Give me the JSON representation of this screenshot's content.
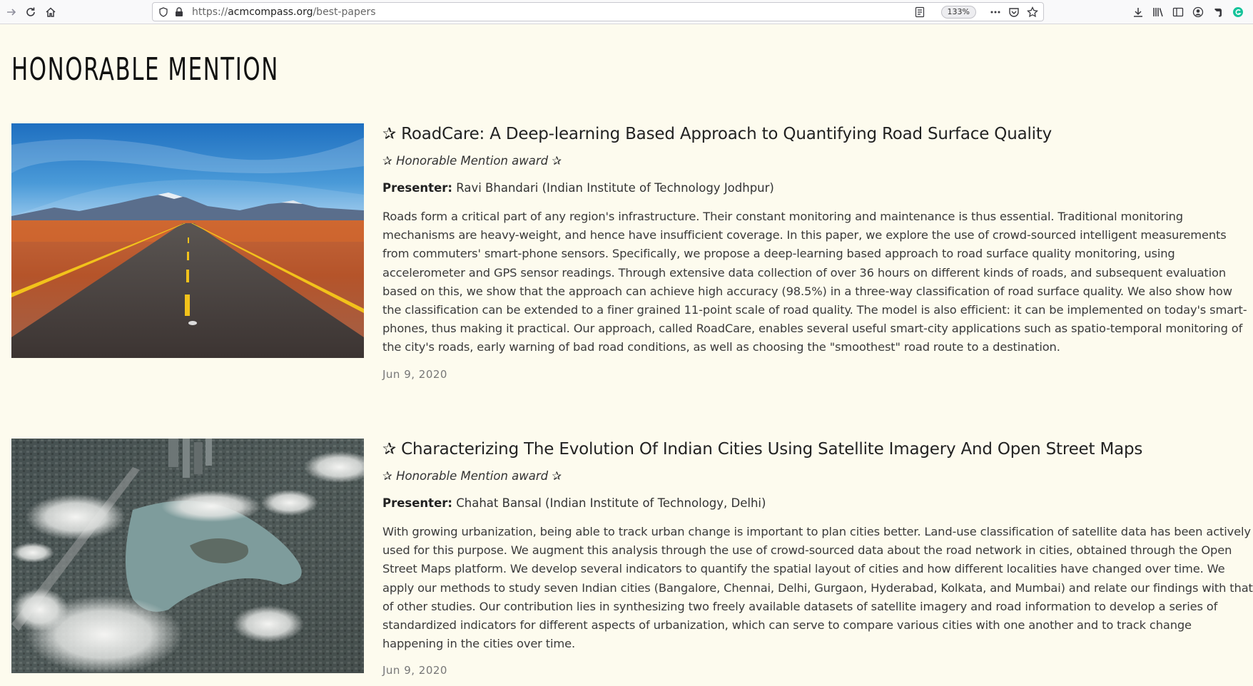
{
  "browser": {
    "url_prefix": "https://",
    "url_host": "acmcompass.org",
    "url_path": "/best-papers",
    "zoom": "133%"
  },
  "page": {
    "title": "HONORABLE MENTION"
  },
  "entries": [
    {
      "title": "✰ RoadCare: A Deep-learning Based Approach to Quantifying Road Surface Quality",
      "award": "✰ Honorable Mention award ✰",
      "presenter_label": "Presenter:",
      "presenter": "Ravi Bhandari (Indian Institute of Technology Jodhpur)",
      "abstract": "Roads form a critical part of any region's infrastructure. Their constant monitoring and maintenance is thus essential. Traditional monitoring mechanisms are heavy-weight, and hence have insufficient coverage. In this paper, we explore the use of crowd-sourced intelligent measurements from commuters' smart-phone sensors. Specifically, we propose a deep-learning based approach to road surface quality monitoring, using accelerometer and GPS sensor readings. Through extensive data collection of over 36 hours on different kinds of roads, and subsequent evaluation based on this, we show that the approach can achieve high accuracy (98.5%) in a three-way classification of road surface quality. We also show how the classification can be extended to a finer grained 11-point scale of road quality. The model is also efficient: it can be implemented on today's smart-phones, thus making it practical. Our approach, called RoadCare, enables several useful smart-city applications such as spatio-temporal monitoring of the city's roads, early warning of bad road conditions, as well as choosing the \"smoothest\" road route to a destination.",
      "date": "Jun 9, 2020"
    },
    {
      "title": "✰ Characterizing The Evolution Of Indian Cities Using Satellite Imagery And Open Street Maps",
      "award": "✰ Honorable Mention award ✰",
      "presenter_label": "Presenter:",
      "presenter": "Chahat Bansal (Indian Institute of Technology, Delhi)",
      "abstract": "With growing urbanization, being able to track urban change is important to plan cities better. Land-use classification of satellite data has been actively used for this purpose. We augment this analysis through the use of crowd-sourced data about the road network in cities, obtained through the Open Street Maps platform. We develop several indicators to quantify the spatial layout of cities and how different localities have changed over time. We apply our methods to study seven Indian cities (Bangalore, Chennai, Delhi, Gurgaon, Hyderabad, Kolkata, and Mumbai) and relate our findings with that of other studies. Our contribution lies in synthesizing two freely available datasets of satellite imagery and road information to develop a series of standardized indicators for different aspects of urbanization, which can serve to compare various cities with one another and to track change happening in the cities over time.",
      "date": "Jun 9, 2020"
    }
  ]
}
